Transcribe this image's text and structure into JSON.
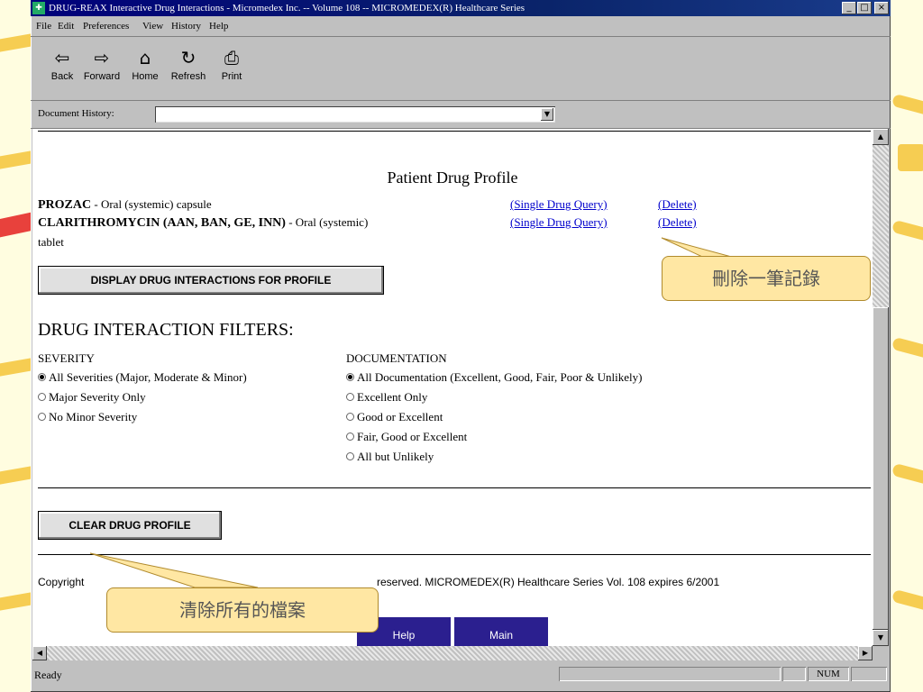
{
  "window": {
    "title": "DRUG-REAX   Interactive Drug Interactions -   Micromedex Inc. -- Volume 108 -- MICROMEDEX(R) Healthcare Series",
    "controls": [
      "_",
      "□",
      "×"
    ]
  },
  "menubar": [
    "File",
    "Edit",
    "Preferences",
    "View",
    "History",
    "Help"
  ],
  "toolbar": [
    {
      "label": "Back",
      "icon": "back-arrow-icon",
      "glyph": "⇦"
    },
    {
      "label": "Forward",
      "icon": "forward-arrow-icon",
      "glyph": "⇨"
    },
    {
      "label": "Home",
      "icon": "home-icon",
      "glyph": "⌂"
    },
    {
      "label": "Refresh",
      "icon": "refresh-icon",
      "glyph": "↻"
    },
    {
      "label": "Print",
      "icon": "printer-icon",
      "glyph": "⎙"
    }
  ],
  "document_history": {
    "label": "Document History:",
    "value": ""
  },
  "profile": {
    "title": "Patient Drug Profile",
    "drugs": [
      {
        "name": "PROZAC",
        "desc": " - Oral (systemic) capsule",
        "query_link": "(Single Drug Query)",
        "delete_link": "(Delete)"
      },
      {
        "name": "CLARITHROMYCIN (AAN, BAN, GE, INN)",
        "desc": " - Oral (systemic)",
        "desc_wrap": "tablet",
        "query_link": "(Single Drug Query)",
        "delete_link": "(Delete)"
      }
    ],
    "display_button": "DISPLAY DRUG INTERACTIONS FOR PROFILE"
  },
  "filters": {
    "title": "DRUG INTERACTION FILTERS:",
    "severity": {
      "label": "SEVERITY",
      "options": [
        "All Severities (Major, Moderate & Minor)",
        "Major Severity Only",
        "No Minor Severity"
      ],
      "selected": 0
    },
    "documentation": {
      "label": "DOCUMENTATION",
      "options": [
        "All Documentation (Excellent, Good, Fair, Poor & Unlikely)",
        "Excellent Only",
        "Good or Excellent",
        "Fair, Good or Excellent",
        "All but Unlikely"
      ],
      "selected": 0
    }
  },
  "clear_button": "CLEAR DRUG PROFILE",
  "copyright": {
    "left": "Copyright",
    "right": "reserved. MICROMEDEX(R) Healthcare Series Vol. 108 expires 6/2001"
  },
  "nav_buttons": [
    "Help",
    "Main"
  ],
  "callouts": {
    "delete": "刪除一筆記錄",
    "clear": "清除所有的檔案"
  },
  "status": {
    "text": "Ready",
    "num": "NUM"
  },
  "colors": {
    "titlebar": "#00007b",
    "link": "#0000cc",
    "callout": "#ffe7a3",
    "nav_button": "#2b1f8f"
  }
}
